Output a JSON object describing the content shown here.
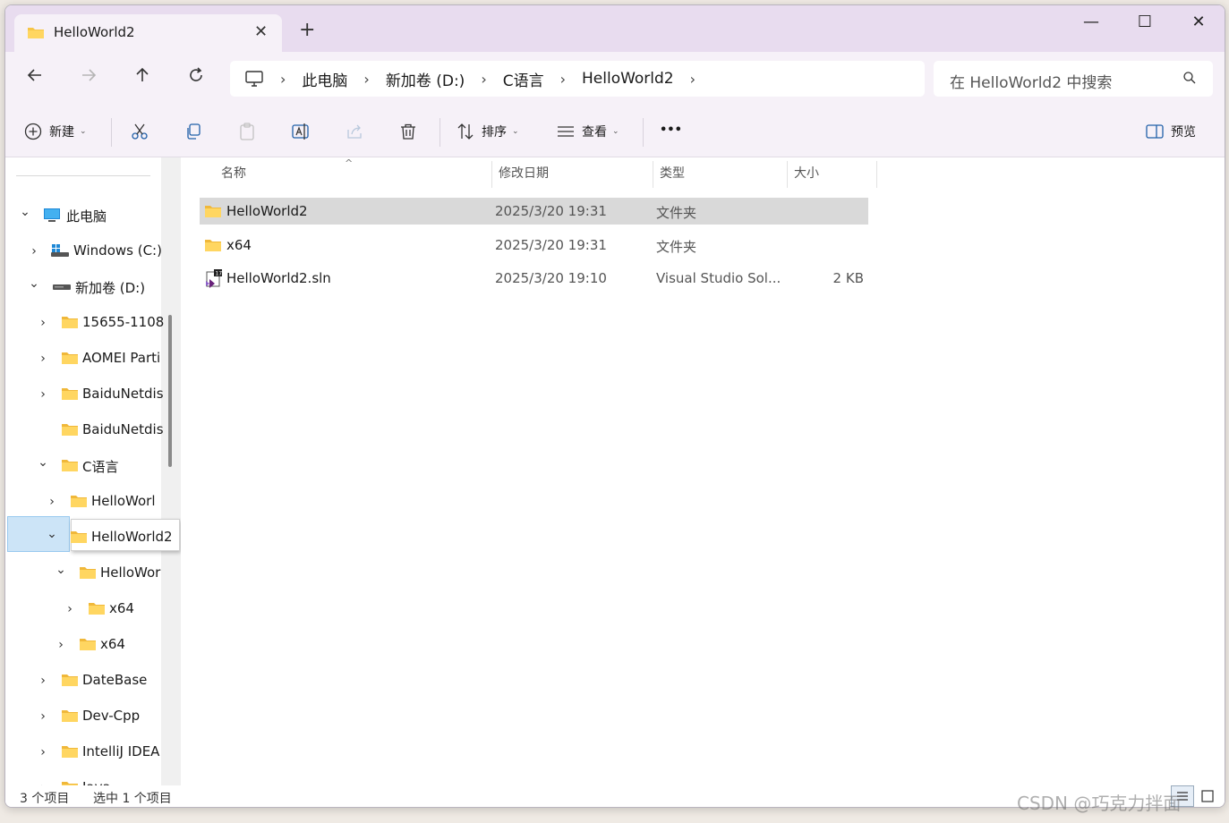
{
  "tab": {
    "title": "HelloWorld2",
    "close_label": "✕",
    "new_tab_label": "+"
  },
  "window_controls": {
    "minimize": "—",
    "maximize": "☐",
    "close": "✕"
  },
  "address": {
    "crumbs": [
      "此电脑",
      "新加卷 (D:)",
      "C语言",
      "HelloWorld2"
    ],
    "separator": "›"
  },
  "search": {
    "placeholder": "在 HelloWorld2 中搜索"
  },
  "toolbar": {
    "new_label": "新建",
    "sort_label": "排序",
    "view_label": "查看",
    "more_label": "•••",
    "preview_label": "预览"
  },
  "columns": {
    "name": "名称",
    "modified": "修改日期",
    "type": "类型",
    "size": "大小"
  },
  "files": [
    {
      "name": "HelloWorld2",
      "modified": "2025/3/20 19:31",
      "type": "文件夹",
      "size": "",
      "icon": "folder-icon",
      "selected": true
    },
    {
      "name": "x64",
      "modified": "2025/3/20 19:31",
      "type": "文件夹",
      "size": "",
      "icon": "folder-icon",
      "selected": false
    },
    {
      "name": "HelloWorld2.sln",
      "modified": "2025/3/20 19:10",
      "type": "Visual Studio Sol...",
      "size": "2 KB",
      "icon": "visual-studio-solution-icon",
      "selected": false
    }
  ],
  "nav_tree": [
    {
      "label": "此电脑",
      "icon": "this-pc-icon",
      "expanded": true,
      "has_chevron": true
    },
    {
      "label": "Windows (C:)",
      "icon": "windows-drive-icon",
      "expanded": false,
      "has_chevron": true
    },
    {
      "label": "新加卷 (D:)",
      "icon": "drive-icon",
      "expanded": true,
      "has_chevron": true
    },
    {
      "label": "15655-1108",
      "icon": "folder-icon",
      "expanded": false,
      "has_chevron": true
    },
    {
      "label": "AOMEI Parti",
      "icon": "folder-icon",
      "expanded": false,
      "has_chevron": true
    },
    {
      "label": "BaiduNetdis",
      "icon": "folder-icon",
      "expanded": false,
      "has_chevron": true
    },
    {
      "label": "BaiduNetdis",
      "icon": "folder-icon",
      "expanded": false,
      "has_chevron": false
    },
    {
      "label": "C语言",
      "icon": "folder-icon",
      "expanded": true,
      "has_chevron": true
    },
    {
      "label": "HelloWorl",
      "icon": "folder-icon",
      "expanded": false,
      "has_chevron": true
    },
    {
      "label": "HelloWorld2",
      "icon": "folder-icon",
      "expanded": true,
      "has_chevron": true
    },
    {
      "label": "HelloWor",
      "icon": "folder-icon",
      "expanded": true,
      "has_chevron": true
    },
    {
      "label": "x64",
      "icon": "folder-icon",
      "expanded": false,
      "has_chevron": true
    },
    {
      "label": "x64",
      "icon": "folder-icon",
      "expanded": false,
      "has_chevron": true
    },
    {
      "label": "DateBase",
      "icon": "folder-icon",
      "expanded": false,
      "has_chevron": true
    },
    {
      "label": "Dev-Cpp",
      "icon": "folder-icon",
      "expanded": false,
      "has_chevron": true
    },
    {
      "label": "IntelliJ IDEA",
      "icon": "folder-icon",
      "expanded": false,
      "has_chevron": true
    },
    {
      "label": "Java",
      "icon": "folder-icon",
      "expanded": false,
      "has_chevron": true
    }
  ],
  "status": {
    "item_count": "3 个项目",
    "selection": "选中 1 个项目"
  },
  "watermark": "CSDN @巧克力拌面",
  "colors": {
    "titlebar": "#e8dcef",
    "toolbar": "#f6f1f8",
    "selection": "#d9d9d9",
    "nav_selection": "#cce4f7",
    "folder": "#f6c548"
  }
}
